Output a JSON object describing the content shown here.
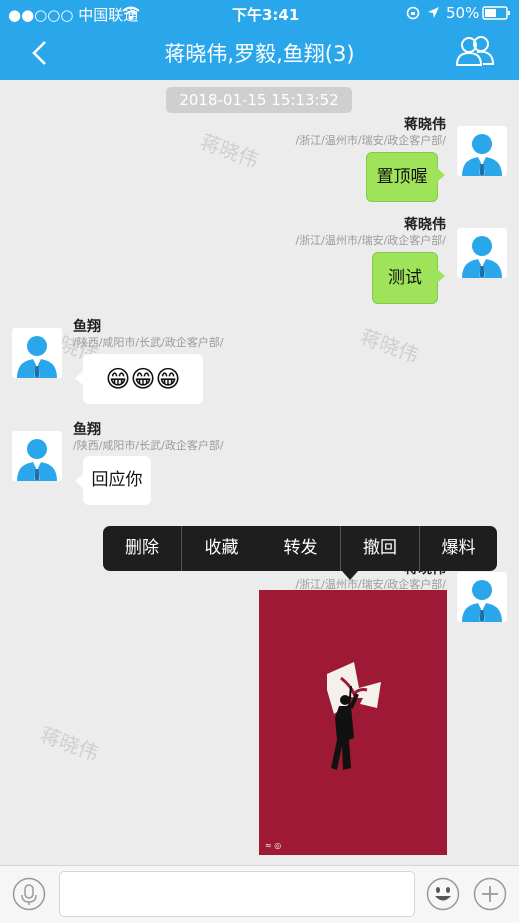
{
  "status_bar": {
    "carrier": "●●○○○ 中国联通",
    "time": "下午3:41",
    "battery": "50%"
  },
  "nav": {
    "title": "蒋晓伟,罗毅,鱼翔(3)"
  },
  "chat": {
    "timestamp": "2018-01-15 15:13:52",
    "watermark": "蒋晓伟",
    "messages": [
      {
        "sender": "蒋晓伟",
        "dept": "/浙江/温州市/瑞安/政企客户部/",
        "text": "置顶喔"
      },
      {
        "sender": "蒋晓伟",
        "dept": "/浙江/温州市/瑞安/政企客户部/",
        "text": "测试"
      },
      {
        "sender": "鱼翔",
        "dept": "/陕西/咸阳市/长武/政企客户部/",
        "text": "😁😁😁"
      },
      {
        "sender": "鱼翔",
        "dept": "/陕西/咸阳市/长武/政企客户部/",
        "text": "回应你"
      },
      {
        "sender": "蒋晓伟",
        "dept": "/浙江/温州市/瑞安/政企客户部/"
      }
    ]
  },
  "context_menu": {
    "items": [
      "删除",
      "收藏",
      "转发",
      "撤回",
      "爆料"
    ]
  },
  "colors": {
    "accent": "#2aa6ea",
    "bubble_green": "#9fe35a",
    "poster_red": "#9e1a34"
  },
  "icons": {
    "back": "chevron-left-icon",
    "members": "group-icon",
    "voice": "microphone-icon",
    "emoji": "smiley-icon",
    "plus": "plus-icon"
  }
}
